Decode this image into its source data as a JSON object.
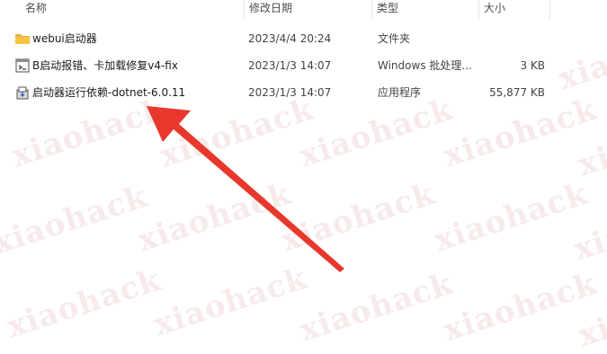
{
  "columns": {
    "name": "名称",
    "date": "修改日期",
    "type": "类型",
    "size": "大小"
  },
  "files": [
    {
      "icon": "folder-icon",
      "name": "webui启动器",
      "date": "2023/4/4 20:24",
      "type": "文件夹",
      "size": ""
    },
    {
      "icon": "batch-file-icon",
      "name": "B启动报错、卡加载修复v4-fix",
      "date": "2023/1/3 14:07",
      "type": "Windows 批处理...",
      "size": "3 KB"
    },
    {
      "icon": "installer-app-icon",
      "name": "启动器运行依赖-dotnet-6.0.11",
      "date": "2023/1/3 14:07",
      "type": "应用程序",
      "size": "55,877 KB"
    }
  ],
  "watermark_text": "xiaohack",
  "colors": {
    "arrow": "#e8382d",
    "folder": "#f5c542",
    "header_text": "#4c4c4c"
  }
}
